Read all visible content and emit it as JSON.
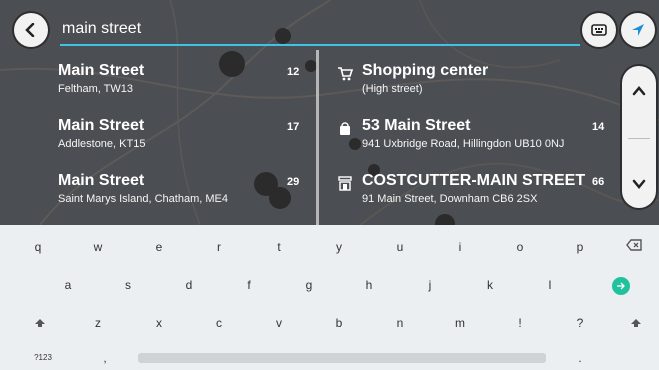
{
  "search": {
    "value": "main street"
  },
  "results_left": [
    {
      "title": "Main Street",
      "subtitle": "Feltham, TW13",
      "distance": "12"
    },
    {
      "title": "Main Street",
      "subtitle": "Addlestone, KT15",
      "distance": "17"
    },
    {
      "title": "Main Street",
      "subtitle": "Saint Marys Island, Chatham, ME4",
      "distance": "29"
    }
  ],
  "results_right": [
    {
      "title": "Shopping center",
      "subtitle": "(High street)",
      "distance": "",
      "icon": "shopping-cart-icon"
    },
    {
      "title": "53 Main Street",
      "subtitle": "941 Uxbridge Road, Hillingdon UB10 0NJ",
      "distance": "14",
      "icon": "shopping-bag-icon"
    },
    {
      "title": "COSTCUTTER-MAIN STREET",
      "subtitle": "91 Main Street, Downham CB6 2SX",
      "distance": "66",
      "icon": "storefront-icon"
    }
  ],
  "keyboard": {
    "row1": [
      "q",
      "w",
      "e",
      "r",
      "t",
      "y",
      "u",
      "i",
      "o",
      "p"
    ],
    "row2": [
      "a",
      "s",
      "d",
      "f",
      "g",
      "h",
      "j",
      "k",
      "l"
    ],
    "row3": [
      "z",
      "x",
      "c",
      "v",
      "b",
      "n",
      "m",
      "!",
      "?"
    ],
    "symbols_key": "?123",
    "comma_key": ",",
    "period_key": "."
  },
  "colors": {
    "accent": "#3ec2e6",
    "enter": "#21c19e",
    "nav_arrow": "#1a8fd6"
  }
}
